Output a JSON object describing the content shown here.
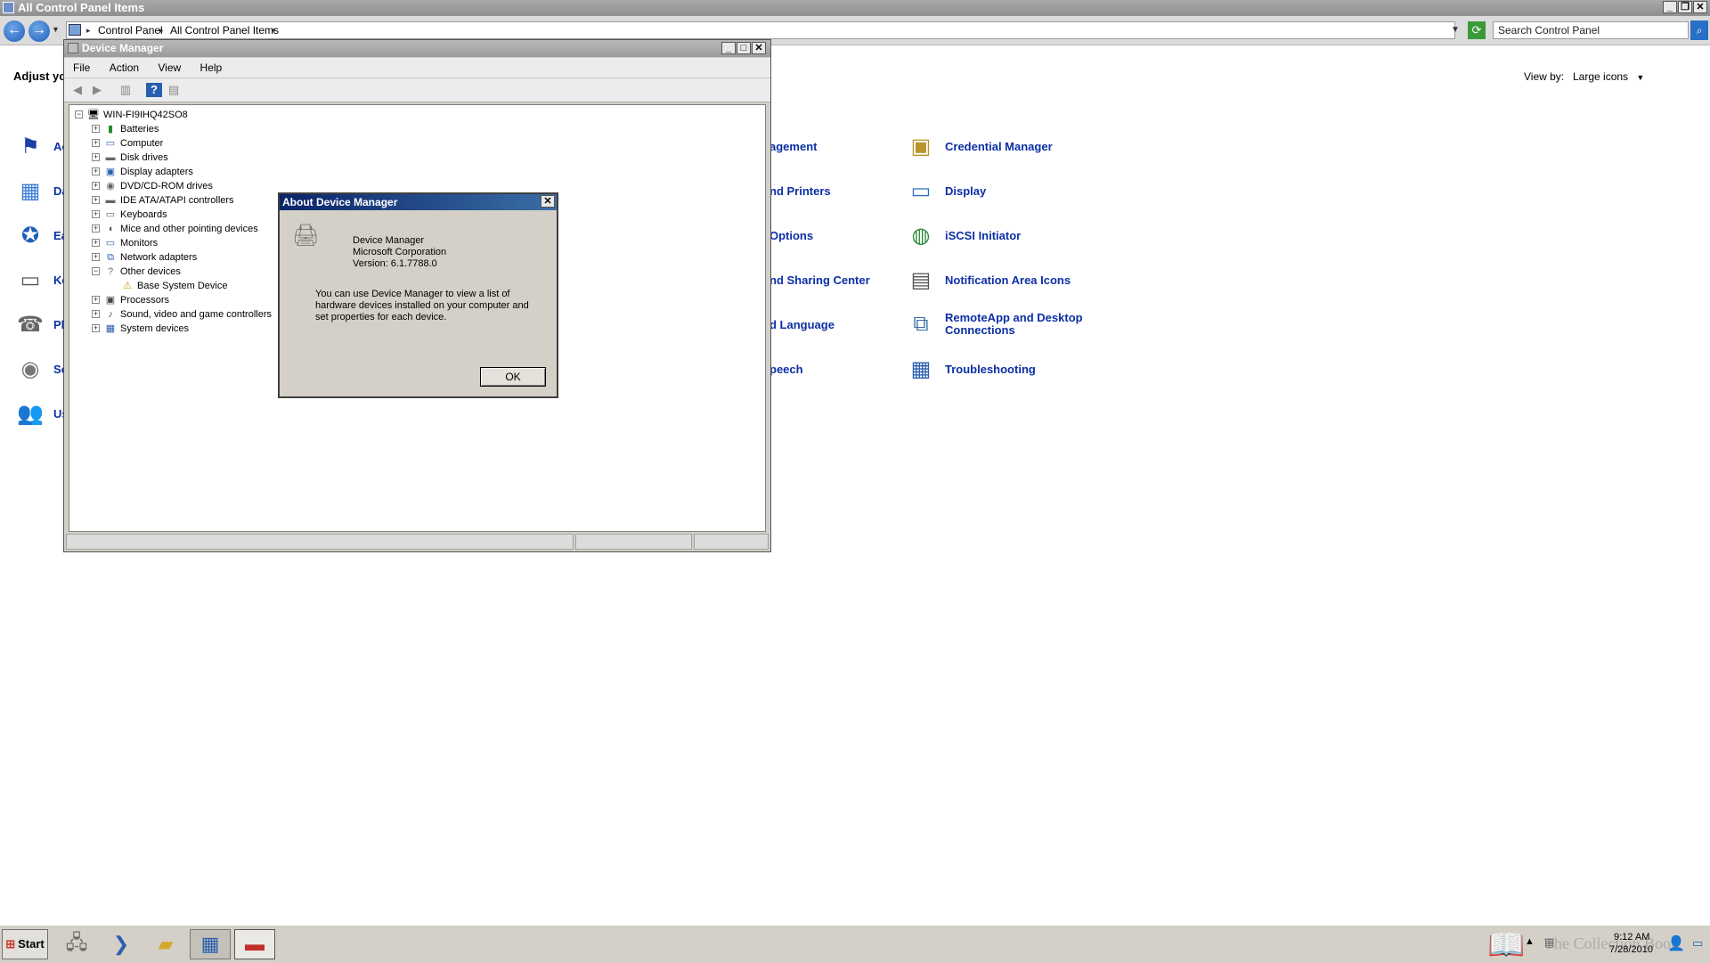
{
  "control_panel": {
    "title": "All Control Panel Items",
    "breadcrumb": [
      "Control Panel",
      "All Control Panel Items"
    ],
    "search_placeholder": "Search Control Panel",
    "heading_partial": "Adjust yo",
    "view_by_label": "View by:",
    "view_by_value": "Large icons",
    "left_column_partial": [
      "Ac",
      "Da",
      "Ea",
      "Ke",
      "Pl",
      "So",
      "Us"
    ],
    "middle_column_partial": [
      "agement",
      "nd Printers",
      "Options",
      "nd Sharing Center",
      "d Language",
      "peech"
    ],
    "right_column": [
      "Credential Manager",
      "Display",
      "iSCSI Initiator",
      "Notification Area Icons",
      "RemoteApp and Desktop Connections",
      "Troubleshooting"
    ]
  },
  "device_manager": {
    "title": "Device Manager",
    "menu": [
      "File",
      "Action",
      "View",
      "Help"
    ],
    "root": "WIN-FI9IHQ42SO8",
    "nodes": [
      "Batteries",
      "Computer",
      "Disk drives",
      "Display adapters",
      "DVD/CD-ROM drives",
      "IDE ATA/ATAPI controllers",
      "Keyboards",
      "Mice and other pointing devices",
      "Monitors",
      "Network adapters",
      "Other devices",
      "Base System Device",
      "Processors",
      "Sound, video and game controllers",
      "System devices"
    ]
  },
  "about_dialog": {
    "title": "About Device Manager",
    "product": "Device Manager",
    "company": "Microsoft Corporation",
    "version": "Version: 6.1.7788.0",
    "description": "You can use Device Manager to view a list of hardware devices installed on your computer and set properties for each device.",
    "ok_label": "OK"
  },
  "taskbar": {
    "start_label": "Start",
    "clock_time": "9:12 AM",
    "clock_date": "7/28/2010",
    "watermark": "The Collection Book"
  },
  "colors": {
    "link": "#0c2fa6",
    "dialog_title": "#0a246a",
    "window_face": "#d4d0c8"
  }
}
